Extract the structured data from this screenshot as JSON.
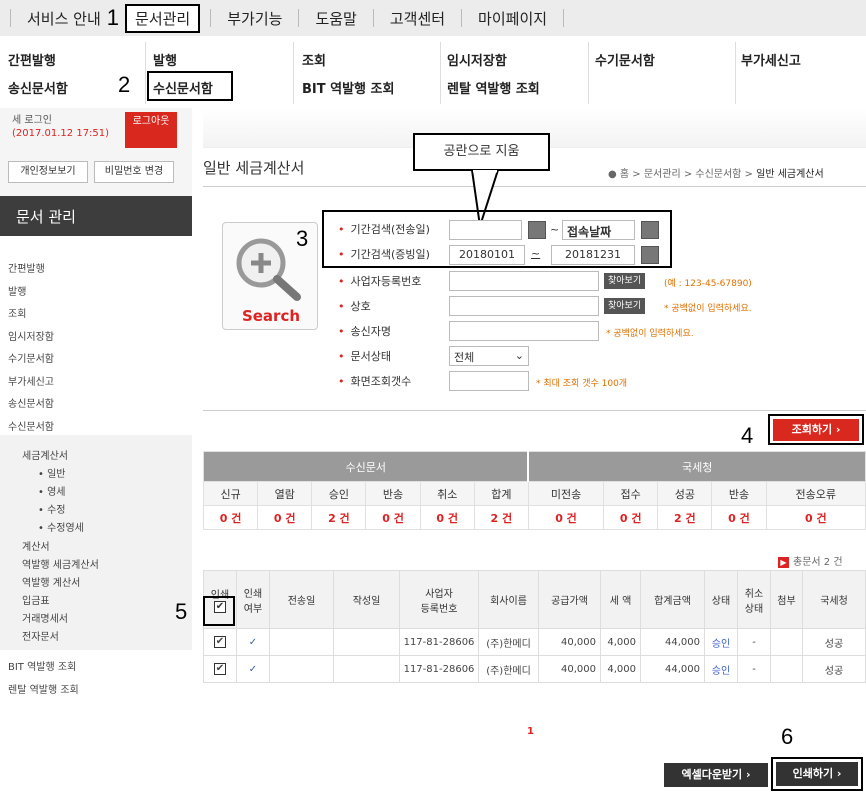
{
  "topnav": {
    "items": [
      "서비스 안내",
      "문서관리",
      "부가기능",
      "도움말",
      "고객센터",
      "마이페이지"
    ]
  },
  "subnav": {
    "row1": [
      "간편발행",
      "발행",
      "조회",
      "임시저장함",
      "수기문서함",
      "부가세신고"
    ],
    "row2": [
      "송신문서함",
      "수신문서함",
      "BIT 역발행 조회",
      "렌탈 역발행 조회"
    ]
  },
  "steps": [
    "1",
    "2",
    "3",
    "4",
    "5",
    "6"
  ],
  "login": {
    "text": "세 로그인",
    "time": "(2017.01.12 17:51)",
    "logout": "로그아웃",
    "profile_btn": "개인정보보기",
    "pw_btn": "비밀번호 변경"
  },
  "sidebar": {
    "header": "문서 관리",
    "items": [
      "간편발행",
      "발행",
      "조회",
      "임시저장함",
      "수기문서함",
      "부가세신고",
      "송신문서함",
      "수신문서함"
    ],
    "sub_header": "세금계산서",
    "sub_items": [
      "• 일반",
      "• 영세",
      "• 수정",
      "• 수정영세"
    ],
    "more_items": [
      "계산서",
      "역발행 세금계산서",
      "역발행 계산서",
      "입금표",
      "거래명세서",
      "전자문서"
    ],
    "bottom_items": [
      "BIT 역발행 조회",
      "렌탈 역발행 조회"
    ]
  },
  "page": {
    "title": "일반 세금계산서",
    "breadcrumb": "● 홈 > 문서관리 > 수신문서함 > ",
    "breadcrumb_current": "일반 세금계산서",
    "callout": "공란으로 지움"
  },
  "search": {
    "label": "Search",
    "fields": [
      {
        "label": "기간검색(전송일)"
      },
      {
        "label": "기간검색(증빙일)"
      },
      {
        "label": "사업자등록번호"
      },
      {
        "label": "상호"
      },
      {
        "label": "송신자명"
      },
      {
        "label": "문서상태"
      },
      {
        "label": "화면조회갯수"
      }
    ],
    "date_sent_from": "",
    "date_sent_to": "접속날짜",
    "date_proof_from": "20180101",
    "tilde": "~",
    "date_proof_to": "20181231",
    "find_btn": "찾아보기",
    "bizno_hint": "(예 : 123-45-67890)",
    "name_hint": "* 공백없이 입력하세요.",
    "sender_hint": "* 공백없이 입력하세요.",
    "status_value": "전체",
    "count_hint": "* 최대 조회 갯수 100개",
    "query_btn": "조회하기 ›"
  },
  "summary": {
    "group1": "수신문서",
    "group2": "국세청",
    "headers": [
      "신규",
      "열람",
      "승인",
      "반송",
      "취소",
      "합계",
      "미전송",
      "접수",
      "성공",
      "반송",
      "전송오류"
    ],
    "values": [
      "0 건",
      "0 건",
      "2 건",
      "0 건",
      "0 건",
      "2 건",
      "0 건",
      "0 건",
      "2 건",
      "0 건",
      "0 건"
    ]
  },
  "list": {
    "total": "총문서 2 건",
    "headers": [
      "인쇄",
      "인쇄\n여부",
      "전송일",
      "작성일",
      "사업자\n등록번호",
      "회사이름",
      "공급가액",
      "세 액",
      "합계금액",
      "상태",
      "취소\n상태",
      "첨부",
      "국세청"
    ],
    "rows": [
      {
        "check": "✔",
        "printed": "✓",
        "sent": "",
        "made": "",
        "bizno": "117-81-28606",
        "company": "(주)한메디",
        "supply": "40,000",
        "tax": "4,000",
        "sum": "44,000",
        "status": "승인",
        "cancel": "-",
        "attach": "",
        "nts": "성공"
      },
      {
        "check": "✔",
        "printed": "✓",
        "sent": "",
        "made": "",
        "bizno": "117-81-28606",
        "company": "(주)한메디",
        "supply": "40,000",
        "tax": "4,000",
        "sum": "44,000",
        "status": "승인",
        "cancel": "-",
        "attach": "",
        "nts": "성공"
      }
    ],
    "page": "1",
    "excel_btn": "엑셀다운받기 ›",
    "print_btn": "인쇄하기 ›"
  }
}
